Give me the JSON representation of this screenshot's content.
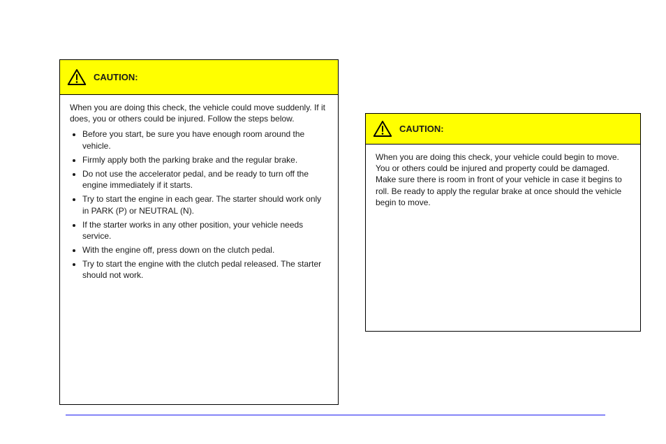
{
  "page": {
    "kind": "vehicle-owner-manual-page",
    "footer_rule_color": "#1a1af0"
  },
  "left_caution": {
    "label": "CAUTION:",
    "intro": "When you are doing this check, the vehicle could move suddenly. If it does, you or others could be injured. Follow the steps below.",
    "items": [
      "Before you start, be sure you have enough room around the vehicle.",
      "Firmly apply both the parking brake and the regular brake.",
      "Do not use the accelerator pedal, and be ready to turn off the engine immediately if it starts.",
      "Try to start the engine in each gear. The starter should work only in PARK (P) or NEUTRAL (N).",
      "If the starter works in any other position, your vehicle needs service.",
      "With the engine off, press down on the clutch pedal.",
      "Try to start the engine with the clutch pedal released. The starter should not work."
    ]
  },
  "right_caution": {
    "label": "CAUTION:",
    "body": "When you are doing this check, your vehicle could begin to move. You or others could be injured and property could be damaged. Make sure there is room in front of your vehicle in case it begins to roll. Be ready to apply the regular brake at once should the vehicle begin to move."
  }
}
